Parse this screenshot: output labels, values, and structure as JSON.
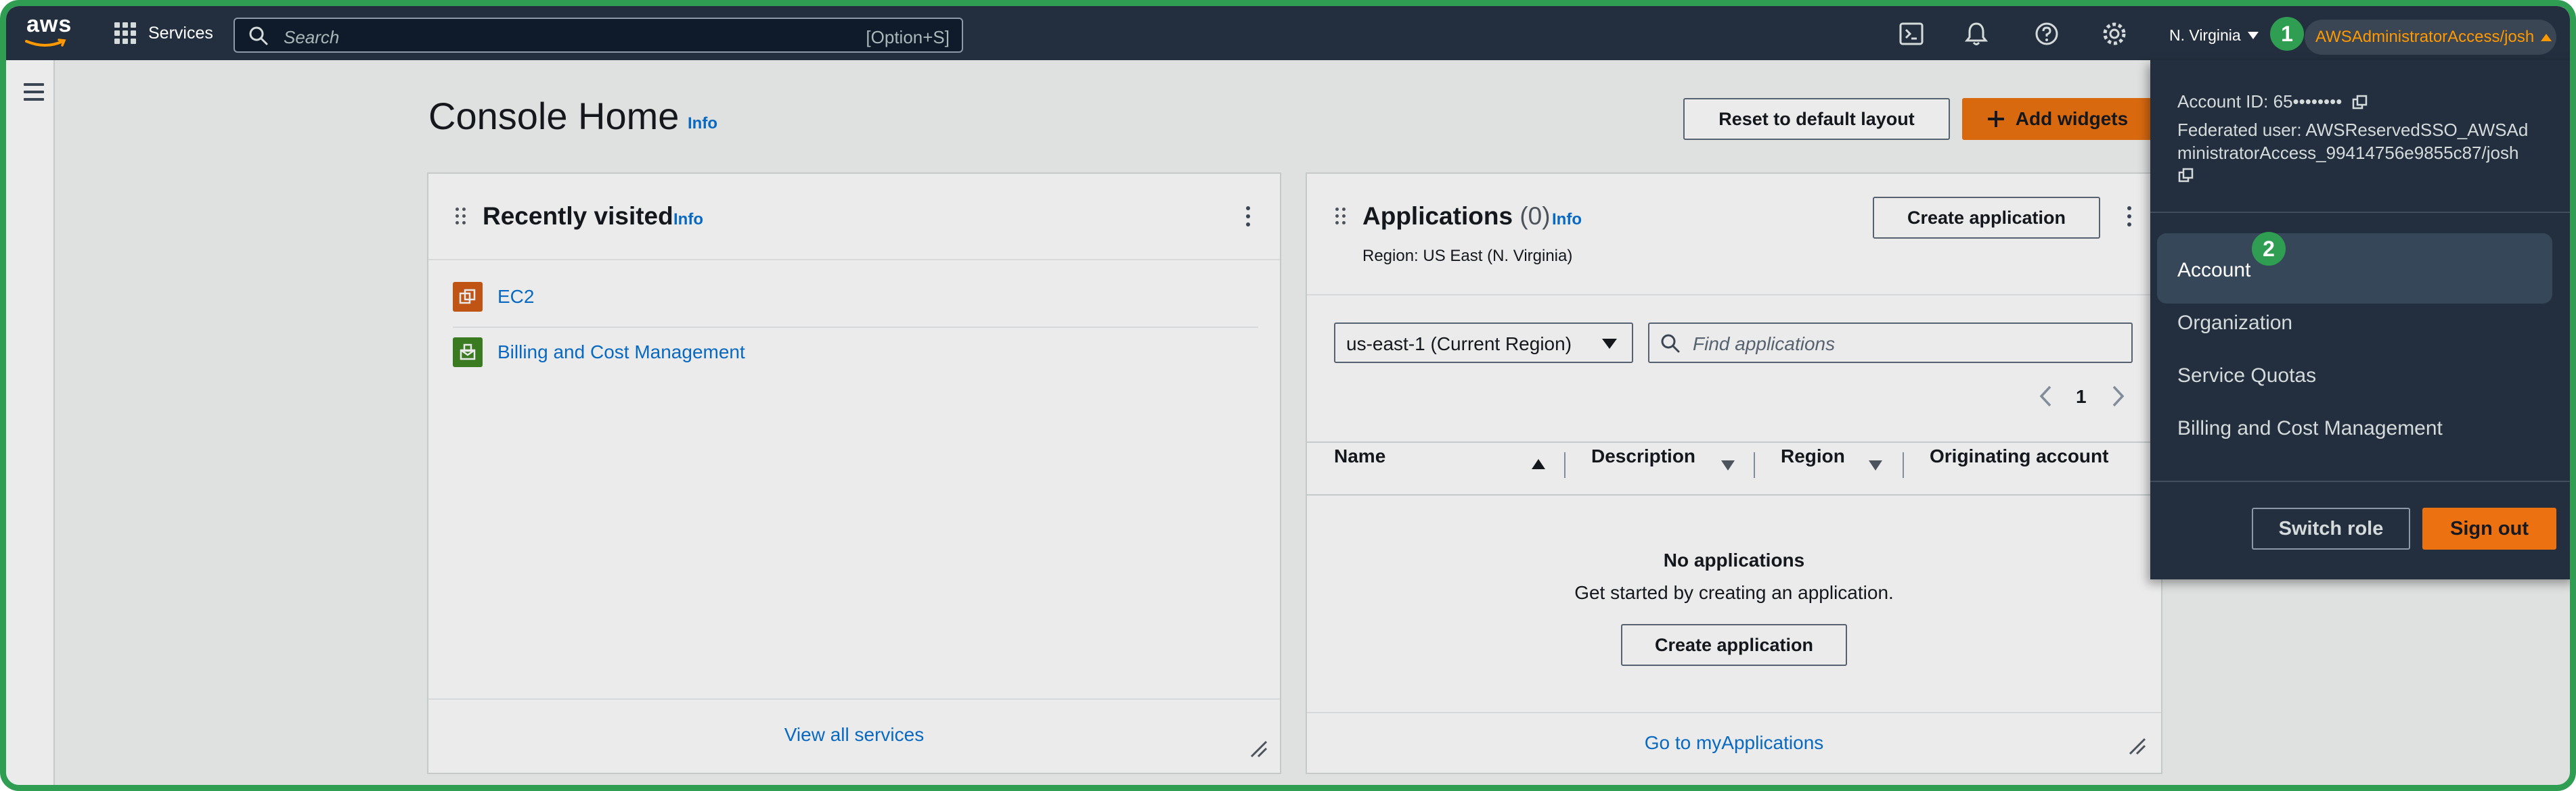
{
  "nav": {
    "logo_text": "aws",
    "services_label": "Services",
    "search_placeholder": "Search",
    "search_shortcut": "[Option+S]",
    "region": "N. Virginia",
    "account_menu_label": "AWSAdministratorAccess/josh",
    "icons": [
      "cloudshell-icon",
      "bell-icon",
      "help-icon",
      "settings-icon"
    ]
  },
  "steps": {
    "step1": "1",
    "step2": "2"
  },
  "page": {
    "title": "Console Home",
    "title_info": "Info",
    "reset_button": "Reset to default layout",
    "add_widgets_button": "Add widgets"
  },
  "recently_visited": {
    "title": "Recently visited",
    "info": "Info",
    "items": [
      {
        "label": "EC2",
        "icon": "ec2-icon",
        "color": "#d05c17"
      },
      {
        "label": "Billing and Cost Management",
        "icon": "billing-icon",
        "color": "#3f8624"
      }
    ],
    "footer_link": "View all services"
  },
  "applications": {
    "title": "Applications",
    "count": "(0)",
    "info": "Info",
    "region_text": "Region: US East (N. Virginia)",
    "create_button": "Create application",
    "region_select": "us-east-1 (Current Region)",
    "find_placeholder": "Find applications",
    "page_number": "1",
    "columns": [
      "Name",
      "Description",
      "Region",
      "Originating account"
    ],
    "empty_title": "No applications",
    "empty_text": "Get started by creating an application.",
    "empty_create_button": "Create application",
    "footer_link": "Go to myApplications"
  },
  "account_menu": {
    "account_id": "Account ID: 65••••••••",
    "federated_line1": "Federated user: AWSReservedSSO_AWSAd",
    "federated_line2": "ministratorAccess_99414756e9855c87/josh",
    "items": [
      "Account",
      "Organization",
      "Service Quotas",
      "Billing and Cost Management"
    ],
    "switch_role": "Switch role",
    "sign_out": "Sign out"
  },
  "colors": {
    "nav_bg": "#232f3e",
    "accent_orange": "#ff9900",
    "primary_button": "#ec7211",
    "link": "#0972d3",
    "step_badge": "#2f9e52"
  }
}
